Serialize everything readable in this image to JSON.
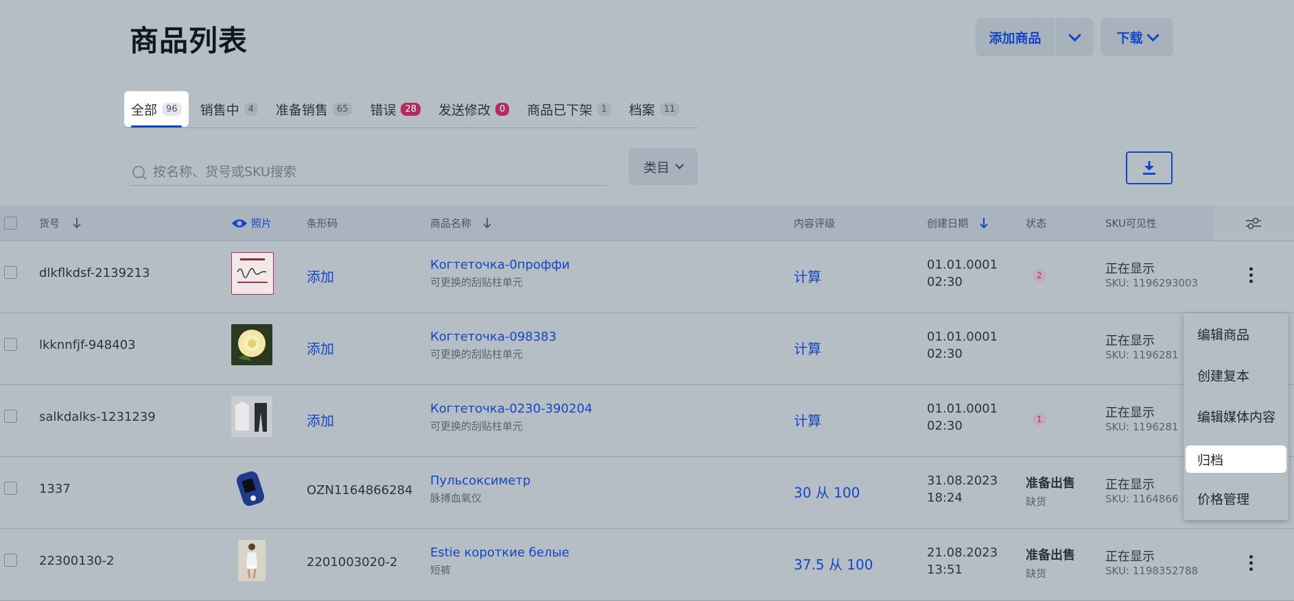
{
  "header": {
    "title": "商品列表",
    "add_label": "添加商品",
    "download_label": "下载"
  },
  "tabs": [
    {
      "label": "全部",
      "count": "96"
    },
    {
      "label": "销售中",
      "count": "4"
    },
    {
      "label": "准备销售",
      "count": "65"
    },
    {
      "label": "错误",
      "count": "28"
    },
    {
      "label": "发送修改",
      "count": "0"
    },
    {
      "label": "商品已下架",
      "count": "1"
    },
    {
      "label": "档案",
      "count": "11"
    }
  ],
  "search": {
    "placeholder": "按名称、货号或SKU搜索",
    "category_label": "类目"
  },
  "table": {
    "headers": {
      "sku_code": "货号",
      "photo": "照片",
      "barcode": "条形码",
      "name": "商品名称",
      "rating": "内容评级",
      "created": "创建日期",
      "status": "状态",
      "visibility": "SKU可见性"
    },
    "rows": [
      {
        "code": "dlkflkdsf-2139213",
        "barcode": "添加",
        "name": "Когтеточка-0проффи",
        "desc": "可更换的刮贴柱单元",
        "rating": "计算",
        "date": "01.01.0001",
        "time": "02:30",
        "status": "",
        "status_sub": "",
        "error_count": "2",
        "vis": "正在显示",
        "sku": "SKU: 1196293003"
      },
      {
        "code": "lkknnfjf-948403",
        "barcode": "添加",
        "name": "Когтеточка-098383",
        "desc": "可更换的刮贴柱单元",
        "rating": "计算",
        "date": "01.01.0001",
        "time": "02:30",
        "status": "",
        "status_sub": "",
        "error_count": "",
        "vis": "正在显示",
        "sku": "SKU: 1196281"
      },
      {
        "code": "salkdalks-1231239",
        "barcode": "添加",
        "name": "Когтеточка-0230-390204",
        "desc": "可更换的刮贴柱单元",
        "rating": "计算",
        "date": "01.01.0001",
        "time": "02:30",
        "status": "",
        "status_sub": "",
        "error_count": "1",
        "vis": "正在显示",
        "sku": "SKU: 1196281"
      },
      {
        "code": "1337",
        "barcode": "OZN1164866284",
        "name": "Пульсоксиметр",
        "desc": "脉搏血氧仪",
        "rating": "30 从 100",
        "date": "31.08.2023",
        "time": "18:24",
        "status": "准备出售",
        "status_sub": "缺货",
        "error_count": "",
        "vis": "正在显示",
        "sku": "SKU: 1164866"
      },
      {
        "code": "22300130-2",
        "barcode": "2201003020-2",
        "name": "Estie короткие белые",
        "desc": "短裤",
        "rating": "37.5 从 100",
        "date": "21.08.2023",
        "time": "13:51",
        "status": "准备出售",
        "status_sub": "缺货",
        "error_count": "",
        "vis": "正在显示",
        "sku": "SKU: 1198352788"
      }
    ]
  },
  "context_menu": {
    "items": [
      "编辑商品",
      "创建复本",
      "编辑媒体内容",
      "归档",
      "价格管理"
    ],
    "highlighted": "归档"
  },
  "colors": {
    "accent": "#1346c7",
    "error": "#b42c5c",
    "background": "#b5bdc5"
  }
}
